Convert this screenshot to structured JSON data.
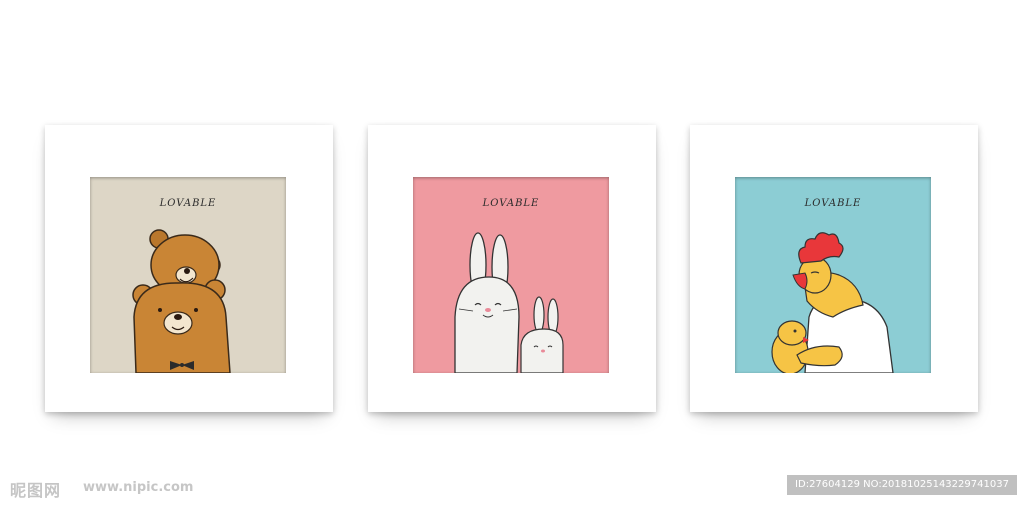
{
  "frames": [
    {
      "title": "LOVABLE",
      "background": "#ddd6c6",
      "subject": "bears"
    },
    {
      "title": "LOVABLE",
      "background": "#ef9aa0",
      "subject": "rabbits"
    },
    {
      "title": "LOVABLE",
      "background": "#8ccdd4",
      "subject": "rooster-and-chick"
    }
  ],
  "watermark": {
    "logo": "昵图网",
    "url": "www.nipic.com",
    "id_text": "ID:27604129 NO:20181025143229741037"
  }
}
